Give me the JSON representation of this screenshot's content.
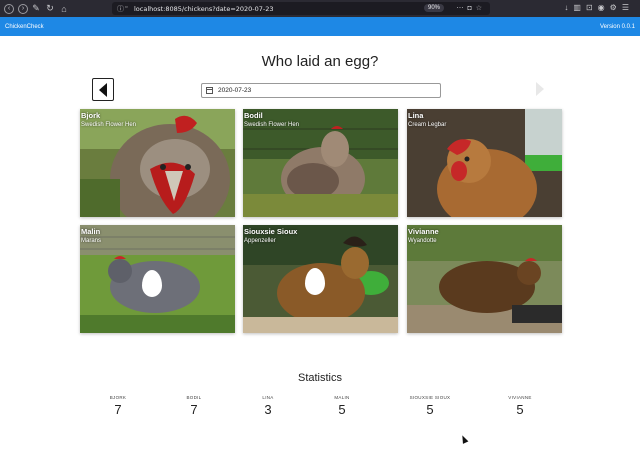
{
  "browser": {
    "url": "localhost:8085/chickens?date=2020-07-23",
    "zoom": "90%"
  },
  "app": {
    "title": "ChickenCheck",
    "version": "Version 0.0.1"
  },
  "page": {
    "heading": "Who laid an egg?",
    "date": "2020-07-23"
  },
  "chickens": [
    {
      "name": "Bjork",
      "breed": "Swedish Flower Hen",
      "laid_egg": false
    },
    {
      "name": "Bodil",
      "breed": "Swedish Flower Hen",
      "laid_egg": false
    },
    {
      "name": "Lina",
      "breed": "Cream Legbar",
      "laid_egg": false
    },
    {
      "name": "Malin",
      "breed": "Marans",
      "laid_egg": true
    },
    {
      "name": "Siouxsie Sioux",
      "breed": "Appenzeller",
      "laid_egg": true
    },
    {
      "name": "Vivianne",
      "breed": "Wyandotte",
      "laid_egg": false
    }
  ],
  "statistics": {
    "title": "Statistics",
    "items": [
      {
        "label": "BJORK",
        "value": "7"
      },
      {
        "label": "BODIL",
        "value": "7"
      },
      {
        "label": "LINA",
        "value": "3"
      },
      {
        "label": "MALIN",
        "value": "5"
      },
      {
        "label": "SIOUXSIE SIOUX",
        "value": "5"
      },
      {
        "label": "VIVIANNE",
        "value": "5"
      }
    ]
  },
  "colors": {
    "app_bar": "#1e88e5",
    "browser_chrome": "#2b2a33"
  }
}
